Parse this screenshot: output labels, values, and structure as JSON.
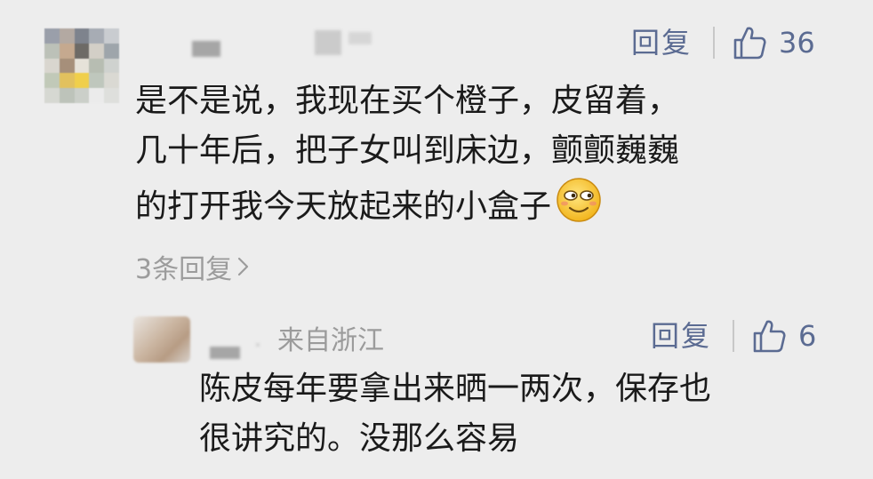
{
  "comment": {
    "reply_label": "回复",
    "like_count": "36",
    "text_lines": [
      "是不是说，我现在买个橙子，皮留着，",
      "几十年后，把子女叫到床边，颤颤巍巍",
      "的打开我今天放起来的小盒子"
    ],
    "emoji": "smiling-face-emoji",
    "reply_count_label": "3条回复",
    "reply_count_chevron": "›"
  },
  "sub_comment": {
    "location": "来自浙江",
    "reply_label": "回复",
    "like_count": "6",
    "text_lines": [
      "陈皮每年要拿出来晒一两次，保存也",
      "很讲究的。没那么容易"
    ]
  },
  "colors": {
    "background": "#ededed",
    "action_blue": "#5b6b92",
    "text": "#1a1a1a",
    "muted": "#9c9c9c"
  },
  "icons": [
    "thumbs-up-icon",
    "chevron-right-icon",
    "smiling-face-emoji"
  ]
}
